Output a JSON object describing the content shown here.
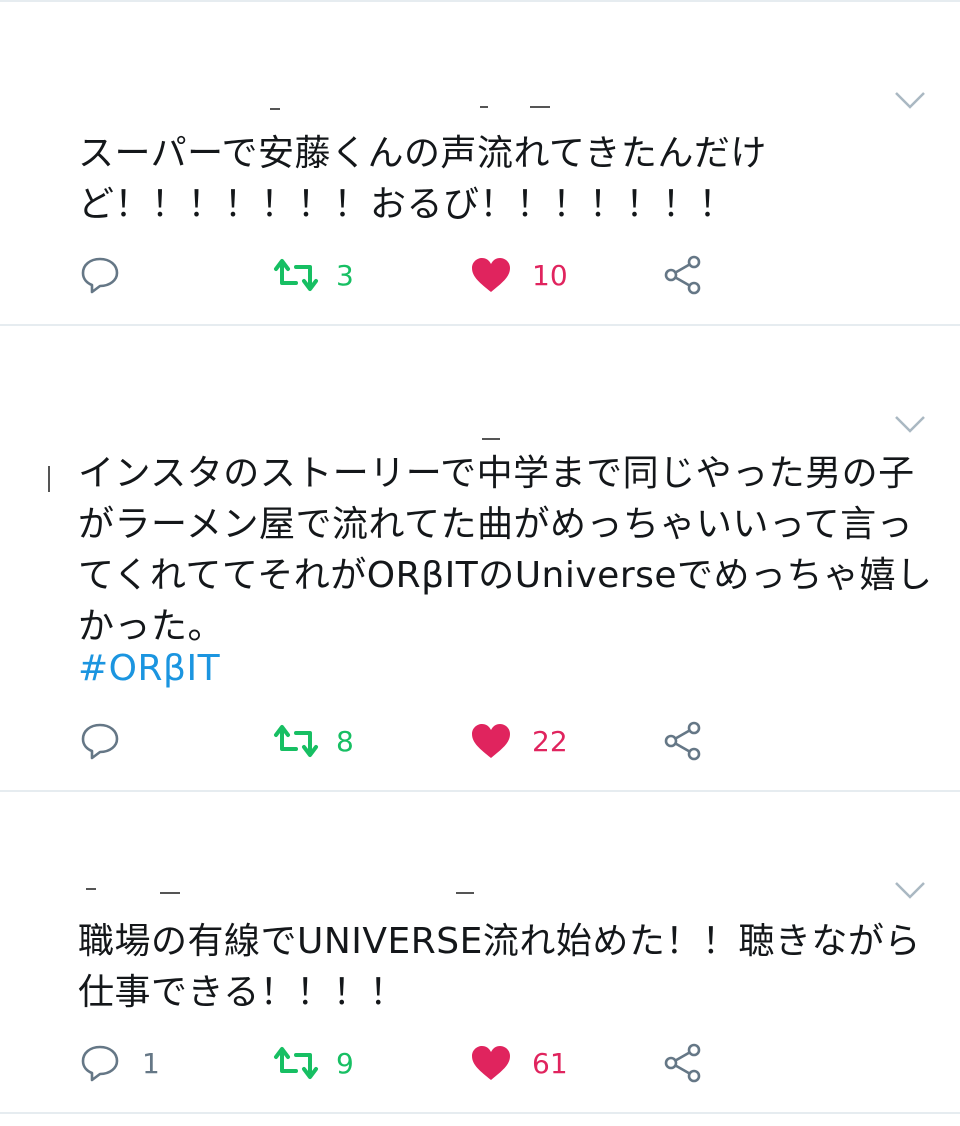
{
  "tweets": [
    {
      "text": "スーパーで安藤くんの声流れてきたんだけど！！！！！！！おるび！！！！！！！",
      "hashtag": "",
      "replies": "",
      "retweets": "3",
      "likes": "10"
    },
    {
      "text": "インスタのストーリーで中学まで同じやった男の子がラーメン屋で流れてた曲がめっちゃいいって言ってくれててそれがORβITのUniverseでめっちゃ嬉しかった。",
      "hashtag": "#ORβIT",
      "replies": "",
      "retweets": "8",
      "likes": "22"
    },
    {
      "text": "職場の有線でUNIVERSE流れ始めた！！聴きながら仕事できる！！！！",
      "hashtag": "",
      "replies": "1",
      "retweets": "9",
      "likes": "61"
    }
  ],
  "colors": {
    "retweet": "#17bf63",
    "like": "#e0245e",
    "hashtag": "#1b95e0",
    "icon_gray": "#657786"
  },
  "icons": [
    "chevron-down-icon",
    "reply-icon",
    "retweet-icon",
    "heart-icon",
    "share-icon"
  ]
}
